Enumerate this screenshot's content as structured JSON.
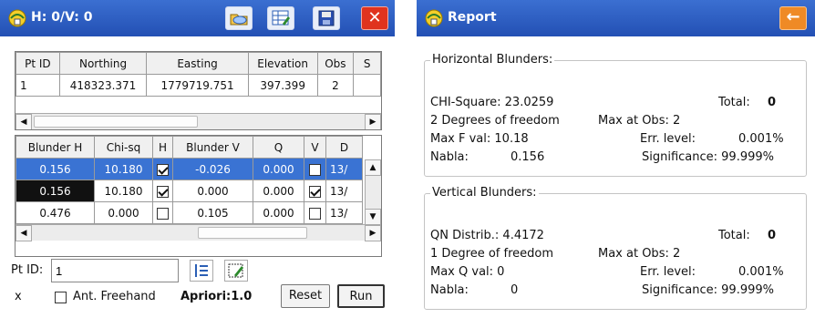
{
  "left_window": {
    "title": "H: 0/V: 0",
    "icons": [
      "folder-open-icon",
      "edit-table-icon",
      "save-icon",
      "close-icon"
    ],
    "close_glyph": "✕",
    "points_table": {
      "headers": [
        "Pt ID",
        "Northing",
        "Easting",
        "Elevation",
        "Obs",
        "S"
      ],
      "rows": [
        [
          "1",
          "418323.371",
          "1779719.751",
          "397.399",
          "2",
          ""
        ]
      ]
    },
    "blunder_table": {
      "headers": [
        "Blunder H",
        "Chi-sq",
        "H",
        "Blunder V",
        "Q",
        "V",
        "D"
      ],
      "rows": [
        {
          "blunder_h": "0.156",
          "chi_sq": "10.180",
          "h_checked": true,
          "blunder_v": "-0.026",
          "q": "0.000",
          "v_checked": false,
          "d": "13/",
          "style": "blue"
        },
        {
          "blunder_h": "0.156",
          "chi_sq": "10.180",
          "h_checked": true,
          "blunder_v": "0.000",
          "q": "0.000",
          "v_checked": true,
          "d": "13/",
          "style": "black"
        },
        {
          "blunder_h": "0.476",
          "chi_sq": "0.000",
          "h_checked": false,
          "blunder_v": "0.105",
          "q": "0.000",
          "v_checked": false,
          "d": "13/",
          "style": "partial"
        }
      ]
    },
    "pt_id_label": "Pt ID:",
    "pt_id_value": "1",
    "x_label": "x",
    "ant_freehand_label": "Ant. Freehand",
    "apriori_label": "Apriori:1.0",
    "reset_label": "Reset",
    "run_label": "Run"
  },
  "right_window": {
    "title": "Report",
    "back_glyph": "←",
    "horizontal": {
      "title": "Horizontal Blunders:",
      "chi_square": "CHI-Square: 23.0259",
      "total_label": "Total:",
      "total_value": "0",
      "dof": "2 Degrees of freedom",
      "max_at_obs": "Max at Obs:  2",
      "max_val": "Max F val: 10.18",
      "err_level_label": "Err. level:",
      "err_level_value": "0.001%",
      "nabla_label": "Nabla:",
      "nabla_value": "0.156",
      "significance": "Significance: 99.999%"
    },
    "vertical": {
      "title": "Vertical Blunders:",
      "distrib": "QN Distrib.: 4.4172",
      "total_label": "Total:",
      "total_value": "0",
      "dof": "1 Degree of freedom",
      "max_at_obs": "Max at Obs:  2",
      "max_val": "Max Q val: 0",
      "err_level_label": "Err. level:",
      "err_level_value": "0.001%",
      "nabla_label": "Nabla:",
      "nabla_value": "0",
      "significance": "Significance: 99.999%"
    }
  },
  "colors": {
    "titlebar": "#2f5fc6",
    "selection_blue": "#3a73d3",
    "close_red": "#e0331e",
    "back_orange": "#ef8a25"
  }
}
